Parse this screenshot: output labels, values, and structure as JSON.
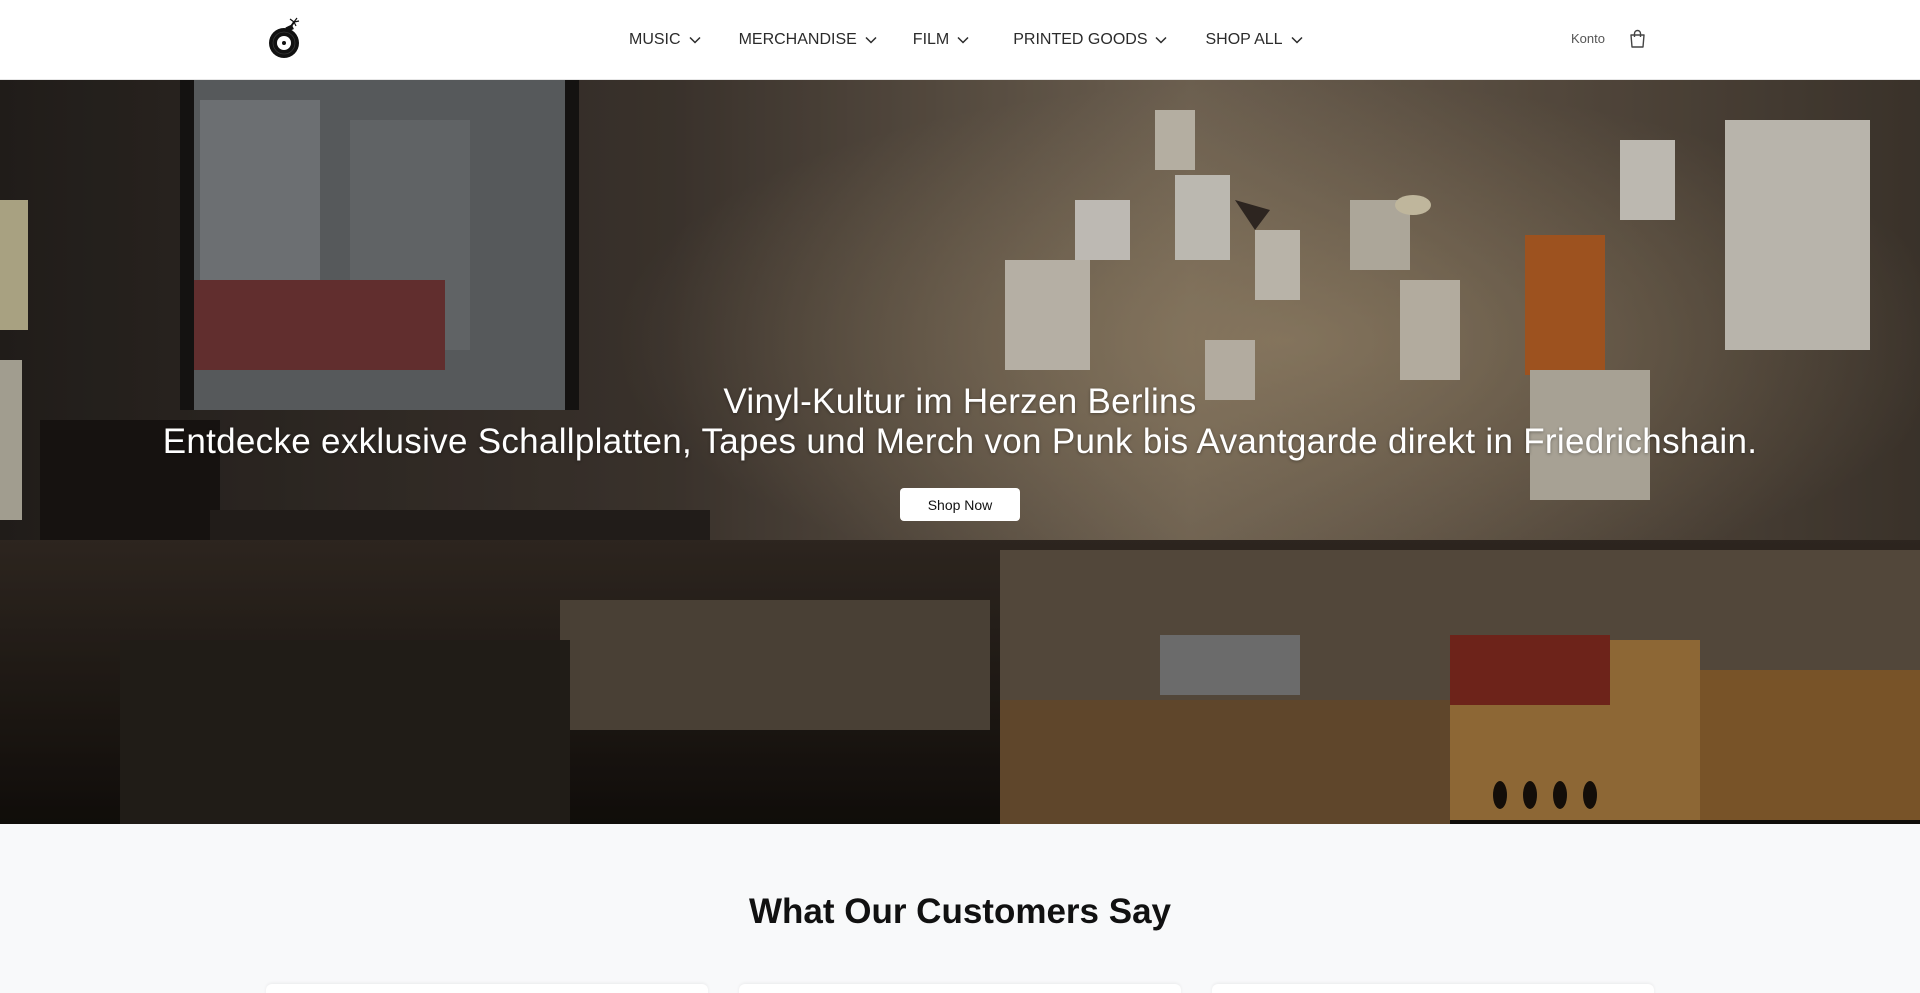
{
  "header": {
    "logo_icon": "record-bomb-logo-icon",
    "nav": [
      {
        "label": "MUSIC",
        "icon": "chevron-down-icon"
      },
      {
        "label": "MERCHANDISE",
        "icon": "chevron-down-icon"
      },
      {
        "label": "FILM",
        "icon": "chevron-down-icon"
      },
      {
        "label": "PRINTED GOODS",
        "icon": "chevron-down-icon"
      },
      {
        "label": "SHOP ALL",
        "icon": "chevron-down-icon"
      }
    ],
    "account_label": "Konto",
    "cart_icon": "shopping-bag-icon"
  },
  "hero": {
    "title": "Vinyl-Kultur im Herzen Berlins",
    "subtitle": "Entdecke exklusive Schallplatten, Tapes und Merch von Punk bis Avantgarde direkt in Friedrichshain.",
    "button_label": "Shop Now"
  },
  "testimonials": {
    "title": "What Our Customers Say"
  },
  "colors": {
    "header_bg": "#ffffff",
    "page_bg": "#f8f9fa",
    "hero_text": "#ffffff",
    "button_bg": "#ffffff"
  }
}
